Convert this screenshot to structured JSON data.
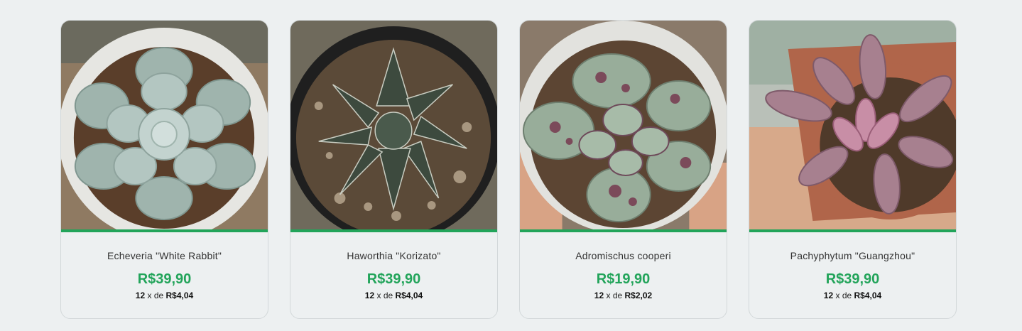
{
  "brand_color": "#22a45a",
  "products": [
    {
      "name": "Echeveria \"White Rabbit\"",
      "price": "R$39,90",
      "installments": "12",
      "installment_sep": "x de",
      "installment_value": "R$4,04",
      "image": "echeveria-photo"
    },
    {
      "name": "Haworthia \"Korizato\"",
      "price": "R$39,90",
      "installments": "12",
      "installment_sep": "x de",
      "installment_value": "R$4,04",
      "image": "haworthia-photo"
    },
    {
      "name": "Adromischus cooperi",
      "price": "R$19,90",
      "installments": "12",
      "installment_sep": "x de",
      "installment_value": "R$2,02",
      "image": "adromischus-photo"
    },
    {
      "name": "Pachyphytum \"Guangzhou\"",
      "price": "R$39,90",
      "installments": "12",
      "installment_sep": "x de",
      "installment_value": "R$4,04",
      "image": "pachyphytum-photo"
    }
  ]
}
